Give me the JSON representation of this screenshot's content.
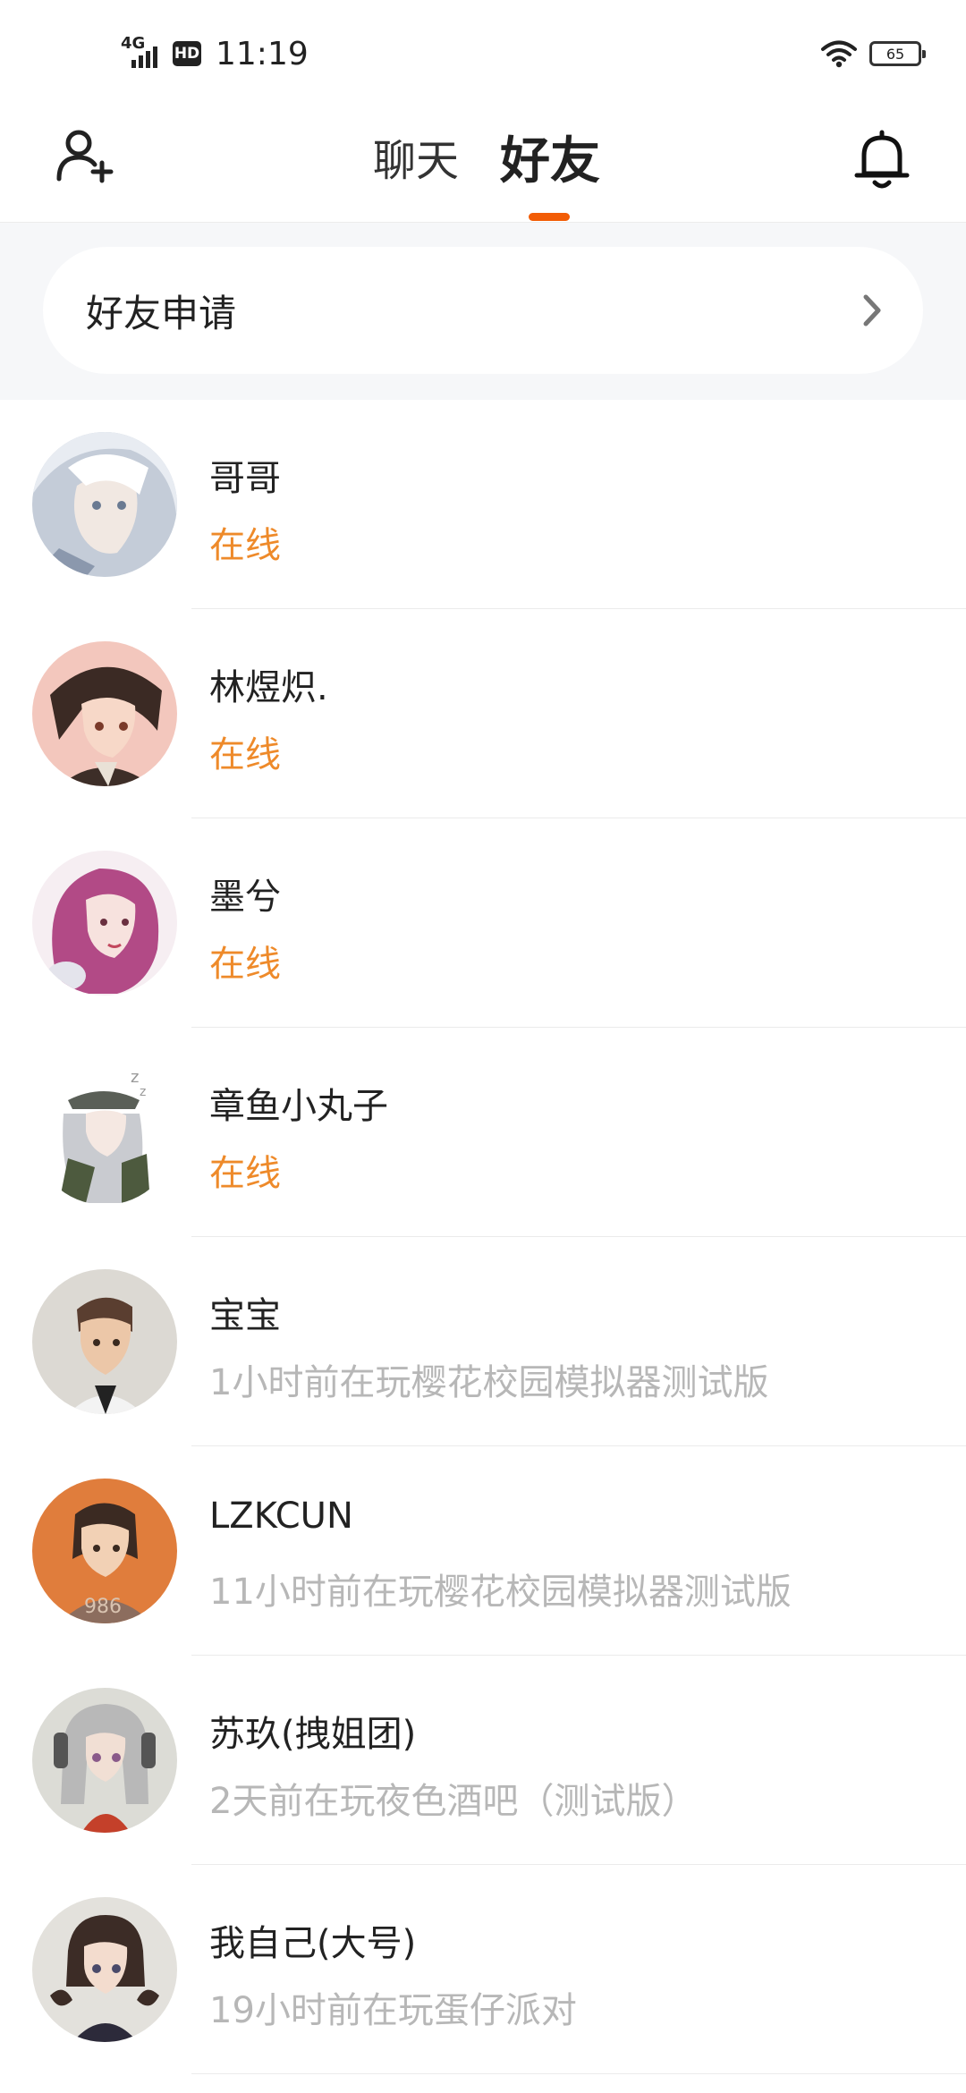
{
  "status_bar": {
    "network": "4G",
    "hd": "HD",
    "time": "11:19",
    "battery": "65"
  },
  "header": {
    "tabs": [
      {
        "label": "聊天",
        "active": false
      },
      {
        "label": "好友",
        "active": true
      }
    ],
    "accent_color": "#f25c05"
  },
  "friend_request": {
    "label": "好友申请"
  },
  "friends": [
    {
      "name": "哥哥",
      "status": "在线",
      "online": true
    },
    {
      "name": "林煜炽.",
      "status": "在线",
      "online": true
    },
    {
      "name": "墨兮",
      "status": "在线",
      "online": true
    },
    {
      "name": "章鱼小丸子",
      "status": "在线",
      "online": true
    },
    {
      "name": "宝宝",
      "status": "1小时前在玩樱花校园模拟器测试版",
      "online": false
    },
    {
      "name": "LZKCUN",
      "status": "11小时前在玩樱花校园模拟器测试版",
      "online": false
    },
    {
      "name": "苏玖(拽姐团)",
      "status": "2天前在玩夜色酒吧（测试版）",
      "online": false
    },
    {
      "name": "我自己(大号)",
      "status": "19小时前在玩蛋仔派对",
      "online": false
    }
  ],
  "colors": {
    "online": "#ee8a2a",
    "offline": "#b7b7b7"
  },
  "icons": {
    "add_friend": "add-friend-icon",
    "notifications": "bell-icon",
    "chevron": "chevron-right-icon",
    "wifi": "wifi-icon",
    "battery": "battery-icon"
  }
}
